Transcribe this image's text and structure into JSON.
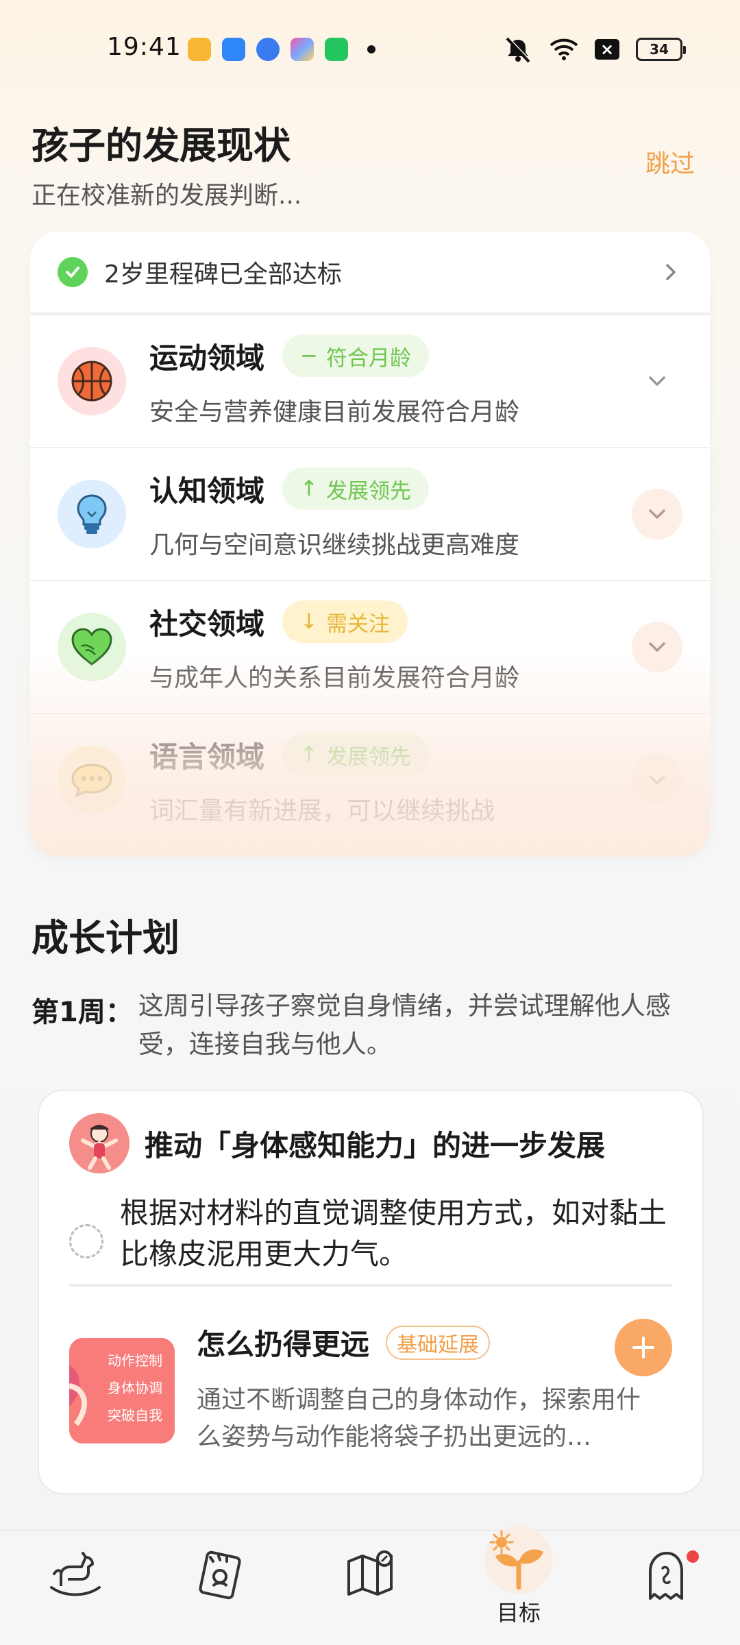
{
  "status_bar": {
    "time": "19:41",
    "battery": "34"
  },
  "header": {
    "title": "孩子的发展现状",
    "subtitle": "正在校准新的发展判断...",
    "skip_label": "跳过"
  },
  "milestone": {
    "text": "2岁里程碑已全部达标"
  },
  "domains": [
    {
      "name": "运动领域",
      "badge": "符合月龄",
      "badge_symbol": "−",
      "description": "安全与营养健康目前发展符合月龄",
      "icon": "basketball-icon"
    },
    {
      "name": "认知领域",
      "badge": "发展领先",
      "badge_symbol": "↑",
      "description": "几何与空间意识继续挑战更高难度",
      "icon": "lightbulb-icon"
    },
    {
      "name": "社交领域",
      "badge": "需关注",
      "badge_symbol": "↓",
      "description": "与成年人的关系目前发展符合月龄",
      "icon": "heart-hands-icon"
    },
    {
      "name": "语言领域",
      "badge": "发展领先",
      "badge_symbol": "↑",
      "description": "词汇量有新进展，可以继续挑战",
      "icon": "speech-bubble-icon"
    }
  ],
  "colors": {
    "accent": "#f2a04a",
    "green": "#6fc651",
    "yellow": "#e7b53a"
  },
  "growth_plan": {
    "title": "成长计划",
    "week_label": "第1周：",
    "week_text": "这周引导孩子察觉自身情绪，并尝试理解他人感受，连接自我与他人。",
    "card": {
      "heading": "推动「身体感知能力」的进一步发展",
      "task": "根据对材料的直觉调整使用方式，如对黏土比橡皮泥用更大力气。",
      "activity_title": "怎么扔得更远",
      "activity_tag": "基础延展",
      "activity_desc": "通过不断调整自己的身体动作，探索用什么姿势与动作能将袋子扔出更远的…",
      "thumb_lines": [
        "动作控制",
        "身体协调",
        "突破自我"
      ]
    }
  },
  "tab_bar": {
    "active_label": "目标"
  }
}
